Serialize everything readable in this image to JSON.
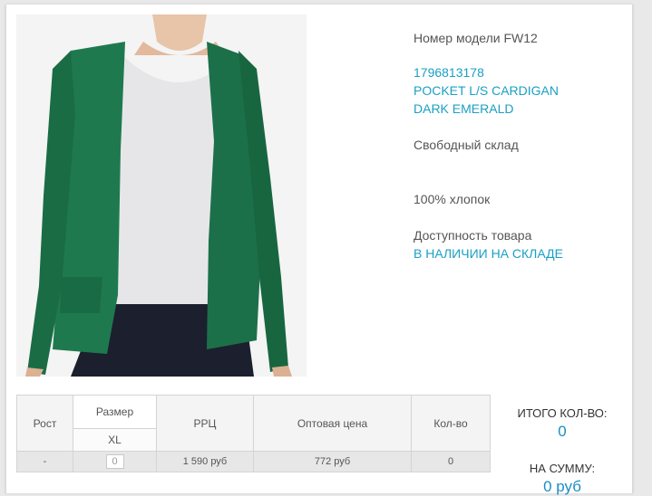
{
  "product": {
    "model_line": "Номер модели FW12",
    "article": "1796813178",
    "name_line1": "POCKET L/S CARDIGAN",
    "name_line2": "DARK EMERALD",
    "warehouse": "Свободный склад",
    "composition": "100% хлопок",
    "availability_label": "Доступность товара",
    "availability_value": "В НАЛИЧИИ НА СКЛАДЕ"
  },
  "table": {
    "headers": {
      "height": "Рост",
      "size": "Размер",
      "rrp": "РРЦ",
      "wholesale": "Оптовая цена",
      "qty": "Кол-во"
    },
    "size_value": "XL",
    "row": {
      "height": "-",
      "size_qty": "0",
      "rrp": "1 590 руб",
      "wholesale": "772 руб",
      "qty": "0"
    }
  },
  "totals": {
    "count_label": "ИТОГО КОЛ-ВО:",
    "count_value": "0",
    "sum_label": "НА СУММУ:",
    "sum_value": "0 руб"
  },
  "colors": {
    "accent": "#1aa0c4",
    "cardigan": "#1e7a4e"
  }
}
